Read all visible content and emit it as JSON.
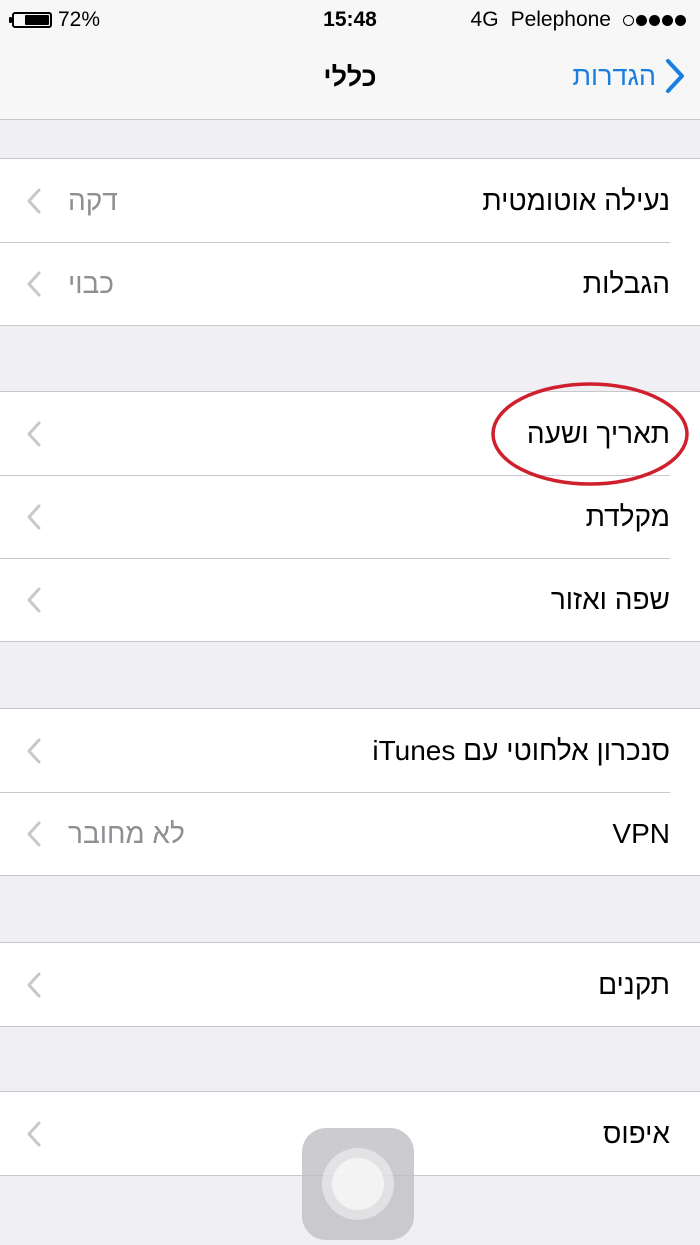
{
  "status_bar": {
    "battery_percent": "72%",
    "battery_level": 0.72,
    "time": "15:48",
    "network": "4G",
    "carrier": "Pelephone",
    "signal_filled": 4,
    "signal_total": 5
  },
  "nav": {
    "title": "כללי",
    "back_label": "הגדרות",
    "accent_color": "#1a7de0"
  },
  "groups": [
    {
      "rows": [
        {
          "label": "נעילה אוטומטית",
          "value": "דקה"
        },
        {
          "label": "הגבלות",
          "value": "כבוי"
        }
      ]
    },
    {
      "rows": [
        {
          "label": "תאריך ושעה",
          "value": ""
        },
        {
          "label": "מקלדת",
          "value": ""
        },
        {
          "label": "שפה ואזור",
          "value": ""
        }
      ]
    },
    {
      "rows": [
        {
          "label": "סנכרון אלחוטי עם iTunes",
          "value": ""
        },
        {
          "label": "VPN",
          "value": "לא מחובר"
        }
      ]
    },
    {
      "rows": [
        {
          "label": "תקנים",
          "value": ""
        }
      ]
    },
    {
      "rows": [
        {
          "label": "איפוס",
          "value": ""
        }
      ]
    }
  ],
  "icons": {
    "chevron": "chevron-left-icon",
    "back": "chevron-right-icon",
    "annotation_color": "#d0202e"
  }
}
